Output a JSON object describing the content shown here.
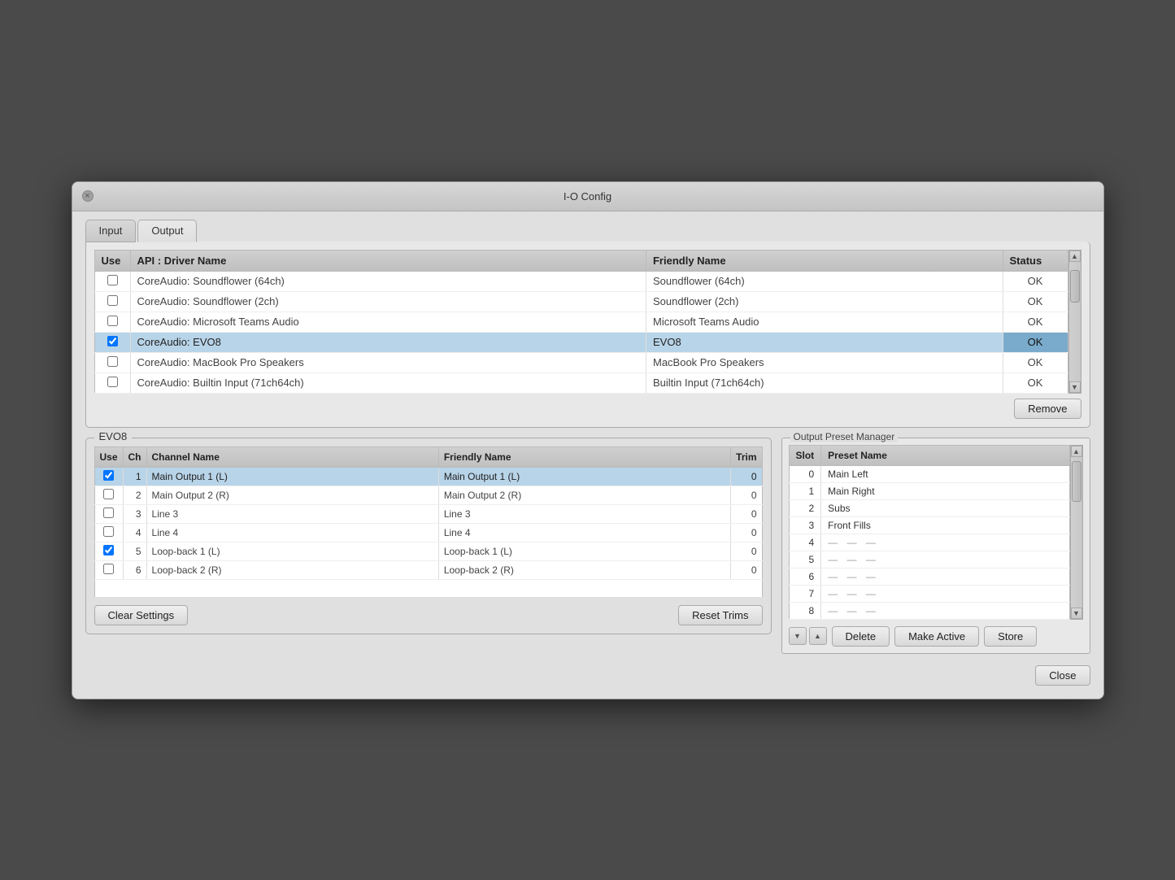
{
  "window": {
    "title": "I-O Config"
  },
  "tabs": [
    {
      "id": "input",
      "label": "Input",
      "active": false
    },
    {
      "id": "output",
      "label": "Output",
      "active": true
    }
  ],
  "device_table": {
    "columns": [
      {
        "key": "use",
        "label": "Use"
      },
      {
        "key": "api_driver",
        "label": "API : Driver Name"
      },
      {
        "key": "friendly",
        "label": "Friendly Name"
      },
      {
        "key": "status",
        "label": "Status"
      }
    ],
    "rows": [
      {
        "use": false,
        "api_driver": "CoreAudio: Soundflower (64ch)",
        "friendly": "Soundflower (64ch)",
        "status": "OK",
        "selected": false
      },
      {
        "use": false,
        "api_driver": "CoreAudio: Soundflower (2ch)",
        "friendly": "Soundflower (2ch)",
        "status": "OK",
        "selected": false
      },
      {
        "use": false,
        "api_driver": "CoreAudio: Microsoft Teams Audio",
        "friendly": "Microsoft Teams Audio",
        "status": "OK",
        "selected": false
      },
      {
        "use": true,
        "api_driver": "CoreAudio: EVO8",
        "friendly": "EVO8",
        "status": "OK",
        "selected": true
      },
      {
        "use": false,
        "api_driver": "CoreAudio: MacBook Pro Speakers",
        "friendly": "MacBook Pro Speakers",
        "status": "OK",
        "selected": false
      },
      {
        "use": false,
        "api_driver": "CoreAudio: Builtin Input (71ch64ch)",
        "friendly": "Builtin Input (71ch64ch)",
        "status": "OK",
        "selected": false
      }
    ]
  },
  "buttons": {
    "remove": "Remove",
    "clear_settings": "Clear Settings",
    "reset_trims": "Reset Trims",
    "delete": "Delete",
    "make_active": "Make Active",
    "store": "Store",
    "close": "Close"
  },
  "evo8_group": {
    "title": "EVO8",
    "columns": [
      {
        "key": "use",
        "label": "Use"
      },
      {
        "key": "ch",
        "label": "Ch"
      },
      {
        "key": "channel_name",
        "label": "Channel Name"
      },
      {
        "key": "friendly",
        "label": "Friendly Name"
      },
      {
        "key": "trim",
        "label": "Trim"
      }
    ],
    "rows": [
      {
        "use": true,
        "ch": 1,
        "channel_name": "Main Output 1 (L)",
        "friendly": "Main Output 1 (L)",
        "trim": 0,
        "selected": true
      },
      {
        "use": false,
        "ch": 2,
        "channel_name": "Main Output 2 (R)",
        "friendly": "Main Output 2 (R)",
        "trim": 0,
        "selected": false
      },
      {
        "use": false,
        "ch": 3,
        "channel_name": "Line 3",
        "friendly": "Line 3",
        "trim": 0,
        "selected": false
      },
      {
        "use": false,
        "ch": 4,
        "channel_name": "Line 4",
        "friendly": "Line 4",
        "trim": 0,
        "selected": false
      },
      {
        "use": true,
        "ch": 5,
        "channel_name": "Loop-back 1 (L)",
        "friendly": "Loop-back 1 (L)",
        "trim": 0,
        "selected": false
      },
      {
        "use": false,
        "ch": 6,
        "channel_name": "Loop-back 2 (R)",
        "friendly": "Loop-back 2 (R)",
        "trim": 0,
        "selected": false
      }
    ]
  },
  "preset_manager": {
    "title": "Output Preset Manager",
    "columns": [
      {
        "key": "slot",
        "label": "Slot"
      },
      {
        "key": "preset_name",
        "label": "Preset Name"
      }
    ],
    "rows": [
      {
        "slot": 0,
        "preset_name": "Main Left",
        "empty": false
      },
      {
        "slot": 1,
        "preset_name": "Main Right",
        "empty": false
      },
      {
        "slot": 2,
        "preset_name": "Subs",
        "empty": false
      },
      {
        "slot": 3,
        "preset_name": "Front Fills",
        "empty": false
      },
      {
        "slot": 4,
        "preset_name": "",
        "empty": true
      },
      {
        "slot": 5,
        "preset_name": "",
        "empty": true
      },
      {
        "slot": 6,
        "preset_name": "",
        "empty": true
      },
      {
        "slot": 7,
        "preset_name": "",
        "empty": true
      },
      {
        "slot": 8,
        "preset_name": "",
        "empty": true
      }
    ],
    "empty_symbol": "— — —"
  }
}
